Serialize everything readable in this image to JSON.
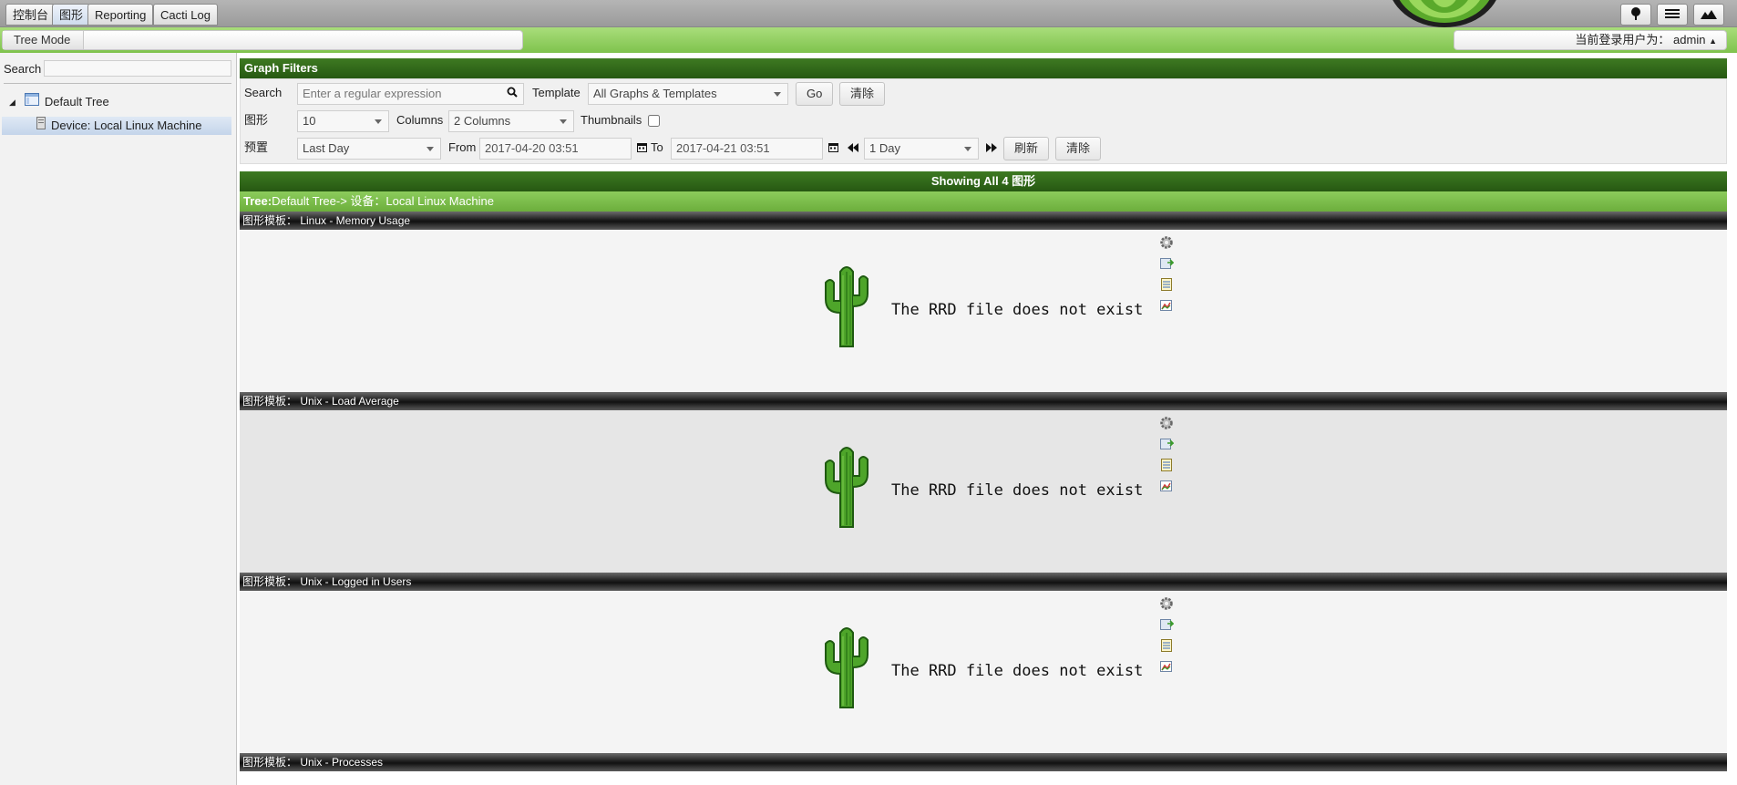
{
  "tabs": [
    "控制台",
    "图形",
    "Reporting",
    "Cacti Log"
  ],
  "breadcrumb": {
    "mode": "Tree Mode"
  },
  "user": {
    "label": "当前登录用户为：",
    "name": "admin"
  },
  "sidebar": {
    "search_label": "Search",
    "tree_root": "Default Tree",
    "device": "Device: Local Linux Machine"
  },
  "filters": {
    "title": "Graph Filters",
    "search_label": "Search",
    "search_placeholder": "Enter a regular expression",
    "template_label": "Template",
    "template_value": "All Graphs & Templates",
    "go_label": "Go",
    "clear_label": "清除",
    "graphs_label": "图形",
    "graphs_value": "10",
    "columns_label": "Columns",
    "columns_value": "2 Columns",
    "thumbnails_label": "Thumbnails",
    "preset_label": "预置",
    "preset_value": "Last Day",
    "from_label": "From",
    "from_value": "2017-04-20 03:51",
    "to_label": "To",
    "to_value": "2017-04-21 03:51",
    "span_value": "1 Day",
    "refresh_label": "刷新",
    "clear2_label": "清除"
  },
  "results": {
    "showing": "Showing All 4 图形",
    "tree_prefix": "Tree:",
    "tree_path": "Default Tree-> 设备：Local Linux Machine"
  },
  "graphs": [
    {
      "title": "图形模板： Linux - Memory Usage",
      "message": "The RRD file does not exist"
    },
    {
      "title": "图形模板： Unix - Load Average",
      "message": "The RRD file does not exist"
    },
    {
      "title": "图形模板： Unix - Logged in Users",
      "message": "The RRD file does not exist"
    },
    {
      "title": "图形模板： Unix - Processes",
      "message": ""
    }
  ],
  "colors": {
    "header_green": "#2f6a1a",
    "light_green": "#7fc34d",
    "graph_header": "#1e1e1e"
  }
}
